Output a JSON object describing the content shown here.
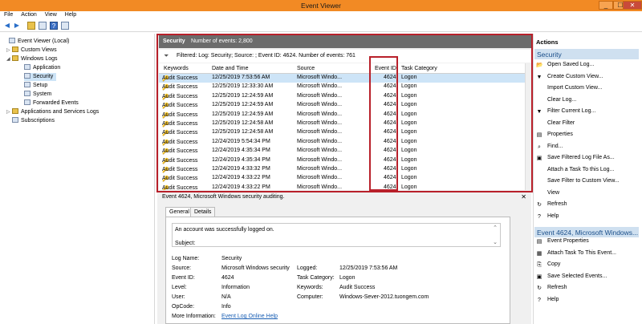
{
  "window": {
    "title": "Event Viewer",
    "min": "_",
    "max": "☐",
    "close": "✕"
  },
  "menu": [
    "File",
    "Action",
    "View",
    "Help"
  ],
  "tree": [
    {
      "label": "Event Viewer (Local)",
      "arrow": ""
    },
    {
      "label": "Custom Views",
      "arrow": "▷"
    },
    {
      "label": "Windows Logs",
      "arrow": "◢"
    },
    {
      "label": "Application",
      "arrow": ""
    },
    {
      "label": "Security",
      "arrow": ""
    },
    {
      "label": "Setup",
      "arrow": ""
    },
    {
      "label": "System",
      "arrow": ""
    },
    {
      "label": "Forwarded Events",
      "arrow": ""
    },
    {
      "label": "Applications and Services Logs",
      "arrow": "▷"
    },
    {
      "label": "Subscriptions",
      "arrow": ""
    }
  ],
  "log_header": {
    "name": "Security",
    "count": "Number of events: 2,800"
  },
  "filter_text": "Filtered: Log: Security; Source: ; Event ID: 4624. Number of events: 761",
  "columns": {
    "keywords": "Keywords",
    "datetime": "Date and Time",
    "source": "Source",
    "eventid": "Event ID",
    "category": "Task Category"
  },
  "rows": [
    {
      "kw": "Audit Success",
      "dt": "12/25/2019 7:53:56 AM",
      "src": "Microsoft Windo...",
      "id": "4624",
      "cat": "Logon"
    },
    {
      "kw": "Audit Success",
      "dt": "12/25/2019 12:33:30 AM",
      "src": "Microsoft Windo...",
      "id": "4624",
      "cat": "Logon"
    },
    {
      "kw": "Audit Success",
      "dt": "12/25/2019 12:24:59 AM",
      "src": "Microsoft Windo...",
      "id": "4624",
      "cat": "Logon"
    },
    {
      "kw": "Audit Success",
      "dt": "12/25/2019 12:24:59 AM",
      "src": "Microsoft Windo...",
      "id": "4624",
      "cat": "Logon"
    },
    {
      "kw": "Audit Success",
      "dt": "12/25/2019 12:24:59 AM",
      "src": "Microsoft Windo...",
      "id": "4624",
      "cat": "Logon"
    },
    {
      "kw": "Audit Success",
      "dt": "12/25/2019 12:24:58 AM",
      "src": "Microsoft Windo...",
      "id": "4624",
      "cat": "Logon"
    },
    {
      "kw": "Audit Success",
      "dt": "12/25/2019 12:24:58 AM",
      "src": "Microsoft Windo...",
      "id": "4624",
      "cat": "Logon"
    },
    {
      "kw": "Audit Success",
      "dt": "12/24/2019 5:54:34 PM",
      "src": "Microsoft Windo...",
      "id": "4624",
      "cat": "Logon"
    },
    {
      "kw": "Audit Success",
      "dt": "12/24/2019 4:35:34 PM",
      "src": "Microsoft Windo...",
      "id": "4624",
      "cat": "Logon"
    },
    {
      "kw": "Audit Success",
      "dt": "12/24/2019 4:35:34 PM",
      "src": "Microsoft Windo...",
      "id": "4624",
      "cat": "Logon"
    },
    {
      "kw": "Audit Success",
      "dt": "12/24/2019 4:33:32 PM",
      "src": "Microsoft Windo...",
      "id": "4624",
      "cat": "Logon"
    },
    {
      "kw": "Audit Success",
      "dt": "12/24/2019 4:33:22 PM",
      "src": "Microsoft Windo...",
      "id": "4624",
      "cat": "Logon"
    },
    {
      "kw": "Audit Success",
      "dt": "12/24/2019 4:33:22 PM",
      "src": "Microsoft Windo...",
      "id": "4624",
      "cat": "Logon"
    }
  ],
  "detail": {
    "title": "Event 4624, Microsoft Windows security auditing.",
    "close": "✕",
    "tabs": [
      "General",
      "Details"
    ],
    "message_line1": "An account was successfully logged on.",
    "message_line2": "Subject:",
    "fields": {
      "log_name_label": "Log Name:",
      "log_name": "Security",
      "source_label": "Source:",
      "source": "Microsoft Windows security",
      "logged_label": "Logged:",
      "logged": "12/25/2019 7:53:56 AM",
      "eventid_label": "Event ID:",
      "eventid": "4624",
      "taskcat_label": "Task Category:",
      "taskcat": "Logon",
      "level_label": "Level:",
      "level": "Information",
      "keywords_label": "Keywords:",
      "keywords": "Audit Success",
      "user_label": "User:",
      "user": "N/A",
      "computer_label": "Computer:",
      "computer": "Windows-Sever-2012.tuongem.com",
      "opcode_label": "OpCode:",
      "opcode": "Info",
      "moreinfo_label": "More Information:",
      "moreinfo": "Event Log Online Help"
    }
  },
  "actions": {
    "title": "Actions",
    "section1": "Security",
    "items1": [
      {
        "label": "Open Saved Log...",
        "icon": "📂"
      },
      {
        "label": "Create Custom View...",
        "icon": "▼"
      },
      {
        "label": "Import Custom View...",
        "icon": ""
      },
      {
        "label": "Clear Log...",
        "icon": ""
      },
      {
        "label": "Filter Current Log...",
        "icon": "▼"
      },
      {
        "label": "Clear Filter",
        "icon": ""
      },
      {
        "label": "Properties",
        "icon": "▤"
      },
      {
        "label": "Find...",
        "icon": "⌕"
      },
      {
        "label": "Save Filtered Log File As...",
        "icon": "▣"
      },
      {
        "label": "Attach a Task To this Log...",
        "icon": ""
      },
      {
        "label": "Save Filter to Custom View...",
        "icon": ""
      },
      {
        "label": "View",
        "icon": ""
      },
      {
        "label": "Refresh",
        "icon": "↻"
      },
      {
        "label": "Help",
        "icon": "?"
      }
    ],
    "section2": "Event 4624, Microsoft Windows...",
    "items2": [
      {
        "label": "Event Properties",
        "icon": "▤"
      },
      {
        "label": "Attach Task To This Event...",
        "icon": "▦"
      },
      {
        "label": "Copy",
        "icon": "⎘"
      },
      {
        "label": "Save Selected Events...",
        "icon": "▣"
      },
      {
        "label": "Refresh",
        "icon": "↻"
      },
      {
        "label": "Help",
        "icon": "?"
      }
    ]
  },
  "colors": {
    "titlebar": "#f28a24",
    "highlight_box": "#b8202a",
    "selection": "#cde4f7",
    "section_header": "#6b6b6b"
  }
}
